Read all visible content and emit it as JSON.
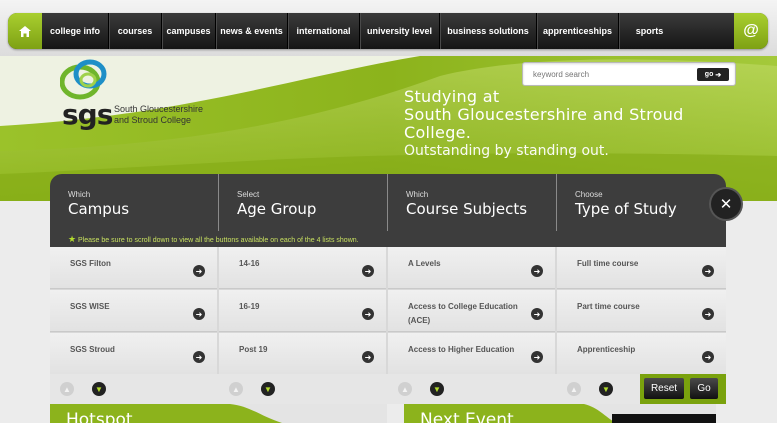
{
  "nav": {
    "items": [
      "college info",
      "courses",
      "campuses",
      "news & events",
      "international",
      "university level",
      "business solutions",
      "apprenticeships",
      "sports"
    ],
    "at_label": "@"
  },
  "logo": {
    "name": "sgs",
    "subtitle_line1": "South Gloucestershire",
    "subtitle_line2": "and Stroud College"
  },
  "search": {
    "placeholder": "keyword search",
    "go_label": "go"
  },
  "tagline": {
    "line1": "Studying at",
    "line2": "South Gloucestershire and Stroud",
    "line3": "College.",
    "line4": "Outstanding by standing out."
  },
  "finder": {
    "columns": [
      {
        "small": "Which",
        "big": "Campus"
      },
      {
        "small": "Select",
        "big": "Age Group"
      },
      {
        "small": "Which",
        "big": "Course Subjects"
      },
      {
        "small": "Choose",
        "big": "Type of Study"
      }
    ],
    "note": "Please be sure to scroll down to view all the buttons available on each of the 4 lists shown.",
    "options": [
      [
        "SGS Filton",
        "SGS WISE",
        "SGS Stroud"
      ],
      [
        "14-16",
        "16-19",
        "Post 19"
      ],
      [
        "A Levels",
        "Access to College Education (ACE)",
        "Access to Higher Education"
      ],
      [
        "Full time course",
        "Part time course",
        "Apprenticeship"
      ]
    ],
    "reset_label": "Reset",
    "go_label": "Go"
  },
  "promos": {
    "left_title": "Hotspot",
    "right_title": "Next Event"
  },
  "colors": {
    "accent": "#8cb31c",
    "dark": "#3d3d3d"
  }
}
